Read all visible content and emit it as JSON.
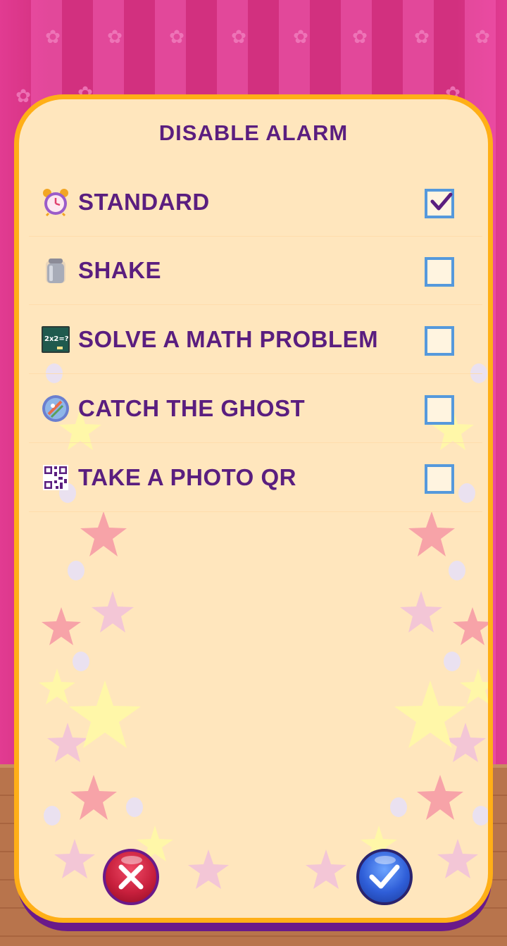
{
  "dialog": {
    "title": "DISABLE ALARM"
  },
  "options": [
    {
      "label": "STANDARD",
      "icon": "alarm-clock-icon",
      "checked": true
    },
    {
      "label": "SHAKE",
      "icon": "shaker-icon",
      "checked": false
    },
    {
      "label": "SOLVE A MATH PROBLEM",
      "icon": "chalkboard-icon",
      "checked": false
    },
    {
      "label": "CATCH THE GHOST",
      "icon": "ghost-target-icon",
      "checked": false
    },
    {
      "label": "TAKE A PHOTO QR",
      "icon": "qr-code-icon",
      "checked": false
    }
  ],
  "buttons": {
    "cancel_icon": "close-icon",
    "confirm_icon": "check-icon"
  },
  "colors": {
    "panel_bg": "#ffe6bd",
    "panel_border": "#ffaf17",
    "text": "#5a1e7f",
    "checkbox": "#5599dc",
    "cancel": "#c8203d",
    "confirm": "#2f5ed8"
  }
}
